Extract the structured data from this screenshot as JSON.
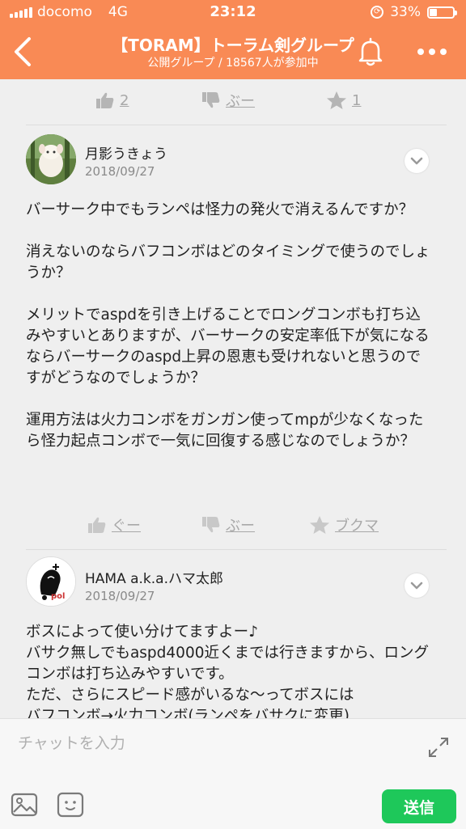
{
  "status_bar": {
    "carrier": "docomo",
    "network": "4G",
    "time": "23:12",
    "battery": "33%",
    "battery_level": 0.33
  },
  "header": {
    "title": "【TORAM】トーラム剣グループ",
    "subtitle": "公開グループ / 18567人が参加中",
    "accent_color": "#f98a55"
  },
  "top_reactions": {
    "good_count": "2",
    "boo_label": "ぶー",
    "bookmark_count": "1"
  },
  "posts": [
    {
      "user": "月影うきょう",
      "date": "2018/09/27",
      "body": "バーサーク中でもランペは怪力の発火で消えるんですか？\n\n消えないのならバフコンボはどのタイミングで使うのでしょうか？\n\nメリットでaspdを引き上げることでロングコンボも打ち込みやすいとありますが、バーサークの安定率低下が気になるならバーサークのaspd上昇の恩恵も受けれないと思うのですがどうなのでしょうか？\n\n運用方法は火力コンボをガンガン使ってmpが少なくなったら怪力起点コンボで一気に回復する感じなのでしょうか？",
      "reactions": {
        "good_label": "ぐー",
        "boo_label": "ぶー",
        "bookmark_label": "ブクマ"
      }
    },
    {
      "user": "HAMA a.k.a.ハマ太郎",
      "date": "2018/09/27",
      "body": "ボスによって使い分けてますよー♪\nバサク無しでもaspd4000近くまでは行きますから、ロングコンボは打ち込みやすいです。\nただ、さらにスピード感がいるな〜ってボスには\nバフコンボ→火力コンボ(ランペをバサクに変更)",
      "avatar_text": "pol"
    }
  ],
  "composer": {
    "placeholder": "チャットを入力",
    "send_label": "送信",
    "send_color": "#1ec85a"
  }
}
